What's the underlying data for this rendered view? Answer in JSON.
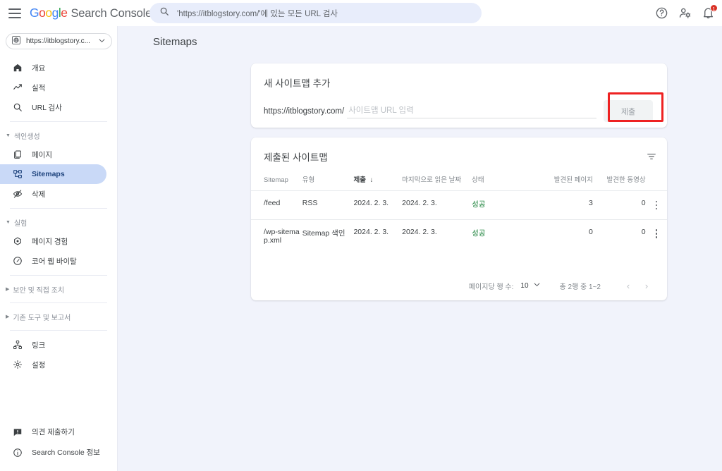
{
  "topbar": {
    "menu_icon": "hamburger-icon",
    "brand": {
      "google": "Google",
      "product": "Search Console"
    },
    "search": {
      "icon": "search-icon",
      "placeholder": "'https://itblogstory.com/'에 있는 모든 URL 검사",
      "value": ""
    },
    "icons": [
      {
        "name": "help-icon"
      },
      {
        "name": "account-settings-icon"
      },
      {
        "name": "notifications-icon",
        "badge": "1"
      }
    ]
  },
  "sidebar": {
    "property": {
      "icon": "globe-icon",
      "label": "https://itblogstory.c...",
      "caret": "chevron-down-icon"
    },
    "items": [
      {
        "label": "개요",
        "icon": "home-icon",
        "selected": false
      },
      {
        "label": "실적",
        "icon": "trending-up-icon",
        "selected": false
      },
      {
        "label": "URL 검사",
        "icon": "search-icon",
        "selected": false
      }
    ],
    "section_index": {
      "label": "색인생성",
      "items": [
        {
          "label": "페이지",
          "icon": "pages-icon",
          "selected": false
        },
        {
          "label": "Sitemaps",
          "icon": "sitemap-icon",
          "selected": true
        },
        {
          "label": "삭제",
          "icon": "eye-off-icon",
          "selected": false
        }
      ]
    },
    "section_experience": {
      "label": "실험",
      "items": [
        {
          "label": "페이지 경험",
          "icon": "page-experience-icon",
          "selected": false
        },
        {
          "label": "코어 웹 바이탈",
          "icon": "speedometer-icon",
          "selected": false
        }
      ]
    },
    "collapsed_sections": [
      {
        "label": "보안 및 직접 조치"
      },
      {
        "label": "기존 도구 및 보고서"
      }
    ],
    "bottom_items": [
      {
        "label": "링크",
        "icon": "links-icon"
      },
      {
        "label": "설정",
        "icon": "gear-icon"
      }
    ],
    "footer_items": [
      {
        "label": "의견 제출하기",
        "icon": "feedback-icon"
      },
      {
        "label": "Search Console 정보",
        "icon": "info-icon"
      }
    ]
  },
  "main": {
    "page_title": "Sitemaps",
    "add_card": {
      "title": "새 사이트맵 추가",
      "url_prefix": "https://itblogstory.com/",
      "input_placeholder": "사이트맵 URL 입력",
      "input_value": "",
      "submit_label": "제출",
      "submit_disabled": true,
      "highlight_color": "#ee2222"
    },
    "list_card": {
      "title": "제출된 사이트맵",
      "filter_icon": "filter-icon",
      "columns": [
        {
          "key": "sitemap",
          "label": "Sitemap",
          "align": "left",
          "sorted": false
        },
        {
          "key": "type",
          "label": "유형",
          "align": "left",
          "sorted": false
        },
        {
          "key": "submitted",
          "label": "제출",
          "align": "left",
          "sorted": true,
          "sort_dir": "desc"
        },
        {
          "key": "last_read",
          "label": "마지막으로 읽은 날짜",
          "align": "left",
          "sorted": false
        },
        {
          "key": "status",
          "label": "상태",
          "align": "left",
          "sorted": false
        },
        {
          "key": "pages_found",
          "label": "발견된 페이지",
          "align": "right",
          "sorted": false
        },
        {
          "key": "videos_found",
          "label": "발견한 동영상",
          "align": "right",
          "sorted": false
        }
      ],
      "rows": [
        {
          "sitemap": "/feed",
          "type": "RSS",
          "submitted": "2024. 2. 3.",
          "last_read": "2024. 2. 3.",
          "status": "성공",
          "status_color": "#188038",
          "pages_found": "3",
          "videos_found": "0",
          "menu_icon": "more-vert-icon"
        },
        {
          "sitemap": "/wp-sitemap.xml",
          "type": "Sitemap 색인",
          "submitted": "2024. 2. 3.",
          "last_read": "2024. 2. 3.",
          "status": "성공",
          "status_color": "#188038",
          "pages_found": "0",
          "videos_found": "0",
          "menu_icon": "more-vert-icon"
        }
      ],
      "pagination": {
        "rows_per_page_label": "페이지당 행 수:",
        "rows_per_page_value": "10",
        "range_label": "총 2행 중 1~2",
        "prev_icon": "chevron-left-icon",
        "next_icon": "chevron-right-icon"
      }
    }
  }
}
